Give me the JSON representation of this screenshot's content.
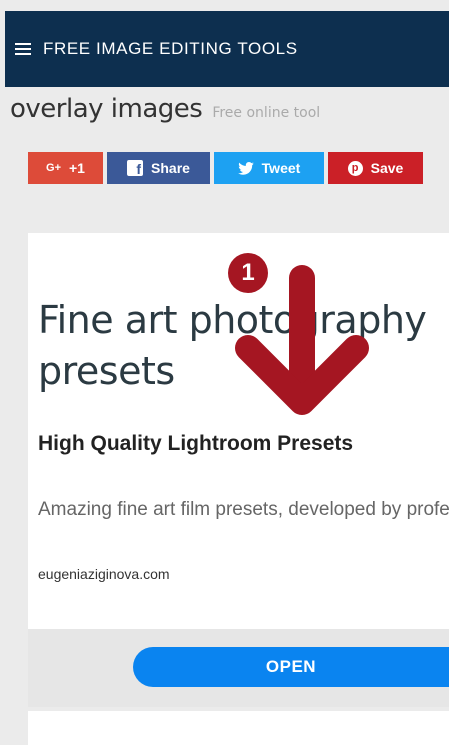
{
  "topbar": {
    "title": "FREE IMAGE EDITING TOOLS",
    "menu_icon": "hamburger-menu-icon"
  },
  "page": {
    "headline": "overlay images",
    "subheadline": "Free online tool"
  },
  "share": {
    "gplus": {
      "icon_text": "G+",
      "label": "+1",
      "color": "#dd4b39"
    },
    "facebook": {
      "icon": "facebook-icon",
      "label": "Share",
      "color": "#3b5998"
    },
    "twitter": {
      "icon": "twitter-icon",
      "label": "Tweet",
      "color": "#1da1f2"
    },
    "pinterest": {
      "icon": "pinterest-icon",
      "label": "Save",
      "color": "#cb2027"
    }
  },
  "ad": {
    "title": "Fine art photography presets",
    "subtitle": "High Quality Lightroom Presets",
    "description": "Amazing fine art film presets, developed by professional photohrapher.",
    "domain": "eugeniaziginova.com",
    "cta_label": "OPEN",
    "cta_color": "#0a84f0"
  },
  "annotation": {
    "step_number": "1",
    "color": "#a51622"
  }
}
